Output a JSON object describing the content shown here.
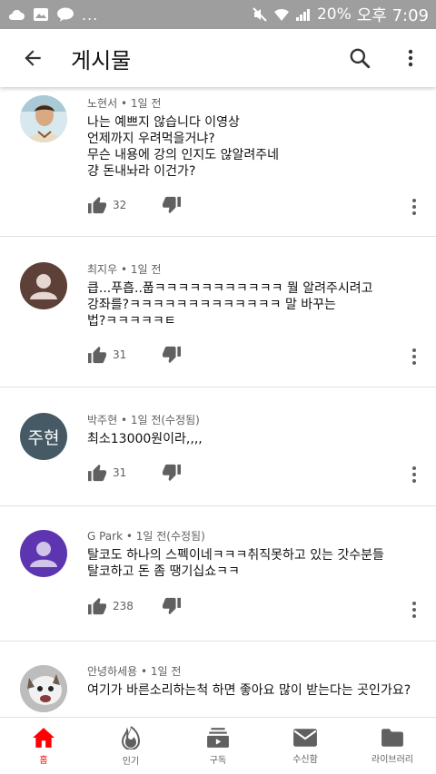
{
  "status_bar": {
    "battery": "20%",
    "time": "오후 7:09",
    "dots": "..."
  },
  "app_bar": {
    "title": "게시물"
  },
  "colors": {
    "accent": "#ff0000",
    "text": "#111111",
    "meta": "#606060",
    "status_bar": "#9e9e9e"
  },
  "comments": [
    {
      "author": "노현서",
      "time": "1일 전",
      "body": "나는 예쁘지 않습니다 이영상\n언제까지 우려먹을거냐?\n무슨 내용에 강의 인지도 않알려주네\n걍 돈내놔라 이건가?",
      "likes": "32"
    },
    {
      "author": "최지우",
      "time": "1일 전",
      "body": "큽...푸흡..풉ㅋㅋㅋㅋㅋㅋㅋㅋㅋㅋㅋ 뭘 알려주시려고\n강좌를?ㅋㅋㅋㅋㅋㅋㅋㅋㅋㅋㅋㅋㅋ 말 바꾸는\n법?ㅋㅋㅋㅋㅋㅌ",
      "likes": "31"
    },
    {
      "author": "박주현",
      "time": "1일 전(수정됨)",
      "avatar_text": "주현",
      "body": "최소13000원이라,,,,",
      "likes": "31"
    },
    {
      "author": "G Park",
      "time": "1일 전(수정됨)",
      "body": "탈코도 하나의 스펙이네ㅋㅋㅋ취직못하고 있는 갓수분들\n탈코하고 돈 좀 땡기십쇼ㅋㅋ",
      "likes": "238"
    },
    {
      "author": "안녕하세용",
      "time": "1일 전",
      "body": "여기가 바른소리하는척 하면 좋아요 많이 받는다는 곳인가요?",
      "likes": ""
    }
  ],
  "bottom_nav": [
    {
      "label": "홈",
      "icon": "home-icon",
      "active": true
    },
    {
      "label": "인기",
      "icon": "trending-icon"
    },
    {
      "label": "구독",
      "icon": "subscriptions-icon"
    },
    {
      "label": "수신함",
      "icon": "inbox-icon"
    },
    {
      "label": "라이브러리",
      "icon": "library-icon"
    }
  ]
}
